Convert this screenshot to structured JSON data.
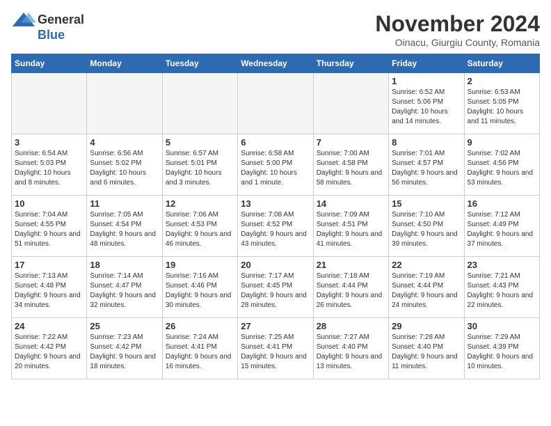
{
  "logo": {
    "general": "General",
    "blue": "Blue"
  },
  "title": {
    "month": "November 2024",
    "location": "Oinacu, Giurgiu County, Romania"
  },
  "weekdays": [
    "Sunday",
    "Monday",
    "Tuesday",
    "Wednesday",
    "Thursday",
    "Friday",
    "Saturday"
  ],
  "weeks": [
    [
      {
        "day": null,
        "info": null
      },
      {
        "day": null,
        "info": null
      },
      {
        "day": null,
        "info": null
      },
      {
        "day": null,
        "info": null
      },
      {
        "day": null,
        "info": null
      },
      {
        "day": "1",
        "info": "Sunrise: 6:52 AM\nSunset: 5:06 PM\nDaylight: 10 hours and 14 minutes."
      },
      {
        "day": "2",
        "info": "Sunrise: 6:53 AM\nSunset: 5:05 PM\nDaylight: 10 hours and 11 minutes."
      }
    ],
    [
      {
        "day": "3",
        "info": "Sunrise: 6:54 AM\nSunset: 5:03 PM\nDaylight: 10 hours and 8 minutes."
      },
      {
        "day": "4",
        "info": "Sunrise: 6:56 AM\nSunset: 5:02 PM\nDaylight: 10 hours and 6 minutes."
      },
      {
        "day": "5",
        "info": "Sunrise: 6:57 AM\nSunset: 5:01 PM\nDaylight: 10 hours and 3 minutes."
      },
      {
        "day": "6",
        "info": "Sunrise: 6:58 AM\nSunset: 5:00 PM\nDaylight: 10 hours and 1 minute."
      },
      {
        "day": "7",
        "info": "Sunrise: 7:00 AM\nSunset: 4:58 PM\nDaylight: 9 hours and 58 minutes."
      },
      {
        "day": "8",
        "info": "Sunrise: 7:01 AM\nSunset: 4:57 PM\nDaylight: 9 hours and 56 minutes."
      },
      {
        "day": "9",
        "info": "Sunrise: 7:02 AM\nSunset: 4:56 PM\nDaylight: 9 hours and 53 minutes."
      }
    ],
    [
      {
        "day": "10",
        "info": "Sunrise: 7:04 AM\nSunset: 4:55 PM\nDaylight: 9 hours and 51 minutes."
      },
      {
        "day": "11",
        "info": "Sunrise: 7:05 AM\nSunset: 4:54 PM\nDaylight: 9 hours and 48 minutes."
      },
      {
        "day": "12",
        "info": "Sunrise: 7:06 AM\nSunset: 4:53 PM\nDaylight: 9 hours and 46 minutes."
      },
      {
        "day": "13",
        "info": "Sunrise: 7:08 AM\nSunset: 4:52 PM\nDaylight: 9 hours and 43 minutes."
      },
      {
        "day": "14",
        "info": "Sunrise: 7:09 AM\nSunset: 4:51 PM\nDaylight: 9 hours and 41 minutes."
      },
      {
        "day": "15",
        "info": "Sunrise: 7:10 AM\nSunset: 4:50 PM\nDaylight: 9 hours and 39 minutes."
      },
      {
        "day": "16",
        "info": "Sunrise: 7:12 AM\nSunset: 4:49 PM\nDaylight: 9 hours and 37 minutes."
      }
    ],
    [
      {
        "day": "17",
        "info": "Sunrise: 7:13 AM\nSunset: 4:48 PM\nDaylight: 9 hours and 34 minutes."
      },
      {
        "day": "18",
        "info": "Sunrise: 7:14 AM\nSunset: 4:47 PM\nDaylight: 9 hours and 32 minutes."
      },
      {
        "day": "19",
        "info": "Sunrise: 7:16 AM\nSunset: 4:46 PM\nDaylight: 9 hours and 30 minutes."
      },
      {
        "day": "20",
        "info": "Sunrise: 7:17 AM\nSunset: 4:45 PM\nDaylight: 9 hours and 28 minutes."
      },
      {
        "day": "21",
        "info": "Sunrise: 7:18 AM\nSunset: 4:44 PM\nDaylight: 9 hours and 26 minutes."
      },
      {
        "day": "22",
        "info": "Sunrise: 7:19 AM\nSunset: 4:44 PM\nDaylight: 9 hours and 24 minutes."
      },
      {
        "day": "23",
        "info": "Sunrise: 7:21 AM\nSunset: 4:43 PM\nDaylight: 9 hours and 22 minutes."
      }
    ],
    [
      {
        "day": "24",
        "info": "Sunrise: 7:22 AM\nSunset: 4:42 PM\nDaylight: 9 hours and 20 minutes."
      },
      {
        "day": "25",
        "info": "Sunrise: 7:23 AM\nSunset: 4:42 PM\nDaylight: 9 hours and 18 minutes."
      },
      {
        "day": "26",
        "info": "Sunrise: 7:24 AM\nSunset: 4:41 PM\nDaylight: 9 hours and 16 minutes."
      },
      {
        "day": "27",
        "info": "Sunrise: 7:25 AM\nSunset: 4:41 PM\nDaylight: 9 hours and 15 minutes."
      },
      {
        "day": "28",
        "info": "Sunrise: 7:27 AM\nSunset: 4:40 PM\nDaylight: 9 hours and 13 minutes."
      },
      {
        "day": "29",
        "info": "Sunrise: 7:28 AM\nSunset: 4:40 PM\nDaylight: 9 hours and 11 minutes."
      },
      {
        "day": "30",
        "info": "Sunrise: 7:29 AM\nSunset: 4:39 PM\nDaylight: 9 hours and 10 minutes."
      }
    ]
  ]
}
